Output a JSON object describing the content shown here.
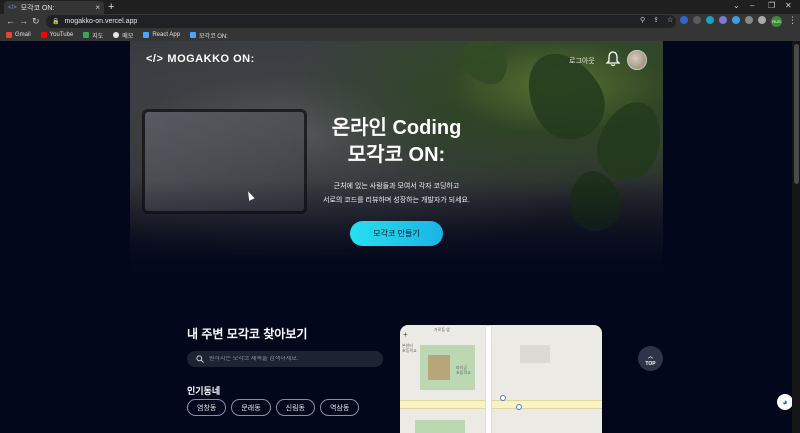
{
  "browser": {
    "tab_title": "모각코 ON:",
    "tab_close": "×",
    "new_tab": "+",
    "url": "mogakko-on.vercel.app",
    "profile_label": "RUS",
    "bookmarks": [
      {
        "label": "Gmail",
        "color": "#ea4335"
      },
      {
        "label": "YouTube",
        "color": "#ff0000"
      },
      {
        "label": "지도",
        "color": "#34a853"
      },
      {
        "label": "메모",
        "color": "#e6e6e6"
      },
      {
        "label": "React App",
        "color": "#4ea3ff"
      },
      {
        "label": "모각코 ON:",
        "color": "#4ea3ff"
      }
    ]
  },
  "header": {
    "logo_mark": "</>",
    "logo_text": "MOGAKKO ON:",
    "logout_label": "로그아웃"
  },
  "hero": {
    "title_line1": "온라인 Coding",
    "title_line2": "모각코 ON:",
    "subtitle_line1": "근처에 있는 사람들과 모여서 각자 코딩하고",
    "subtitle_line2": "서로의 코드를 리뷰하며 성장하는 개발자가 되세요.",
    "cta_label": "모각코 만들기"
  },
  "nearby": {
    "title": "내 주변 모각코 찾아보기",
    "search_placeholder": "원하시는 모각코 제목을 검색하세요.",
    "popular_label": "인기동네",
    "chips": [
      "염창동",
      "문래동",
      "신림동",
      "역삼동"
    ]
  },
  "map": {
    "zoom_in": "+",
    "labels": [
      "가로등 앞",
      "본센터",
      "초등학교",
      "파리공",
      "초등학교"
    ]
  },
  "floating": {
    "top_arrow": "︿",
    "top_label": "TOP"
  },
  "colors": {
    "page_bg": "#02071c",
    "accent": "#27e0ef"
  }
}
